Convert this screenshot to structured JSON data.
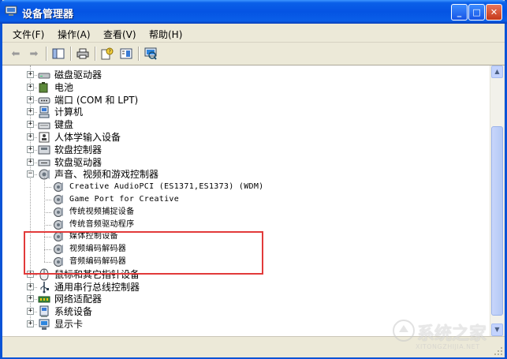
{
  "window": {
    "title": "设备管理器",
    "minimize_glyph": "_",
    "maximize_glyph": "□",
    "close_glyph": "✕"
  },
  "menubar": [
    "文件(F)",
    "操作(A)",
    "查看(V)",
    "帮助(H)"
  ],
  "tree": {
    "categories": [
      {
        "label": "磁盘驱动器",
        "icon": "disk-drive-icon",
        "expander": "+"
      },
      {
        "label": "电池",
        "icon": "battery-icon",
        "expander": "+"
      },
      {
        "label": "端口 (COM 和 LPT)",
        "icon": "port-icon",
        "expander": "+"
      },
      {
        "label": "计算机",
        "icon": "computer-icon",
        "expander": "+"
      },
      {
        "label": "键盘",
        "icon": "keyboard-icon",
        "expander": "+"
      },
      {
        "label": "人体学输入设备",
        "icon": "hid-icon",
        "expander": "+"
      },
      {
        "label": "软盘控制器",
        "icon": "floppy-controller-icon",
        "expander": "+"
      },
      {
        "label": "软盘驱动器",
        "icon": "floppy-drive-icon",
        "expander": "+"
      },
      {
        "label": "声音、视频和游戏控制器",
        "icon": "sound-icon",
        "expander": "−",
        "children": [
          "Creative AudioPCI (ES1371,ES1373) (WDM)",
          "Game Port for Creative",
          "传统视频捕捉设备",
          "传统音频驱动程序",
          "媒体控制设备",
          "视频编码解码器",
          "音频编码解码器"
        ]
      },
      {
        "label": "鼠标和其它指针设备",
        "icon": "mouse-icon",
        "expander": "+"
      },
      {
        "label": "通用串行总线控制器",
        "icon": "usb-icon",
        "expander": "+"
      },
      {
        "label": "网络适配器",
        "icon": "network-adapter-icon",
        "expander": "+"
      },
      {
        "label": "系统设备",
        "icon": "system-device-icon",
        "expander": "+"
      },
      {
        "label": "显示卡",
        "icon": "display-adapter-icon",
        "expander": "+"
      }
    ]
  },
  "watermark": {
    "brand": "系统之家",
    "url": "XITONGZHIJIA.NET"
  },
  "colors": {
    "title_bar": "#0554e3",
    "highlight_border": "#e23a3a",
    "chrome": "#ece9d8"
  }
}
